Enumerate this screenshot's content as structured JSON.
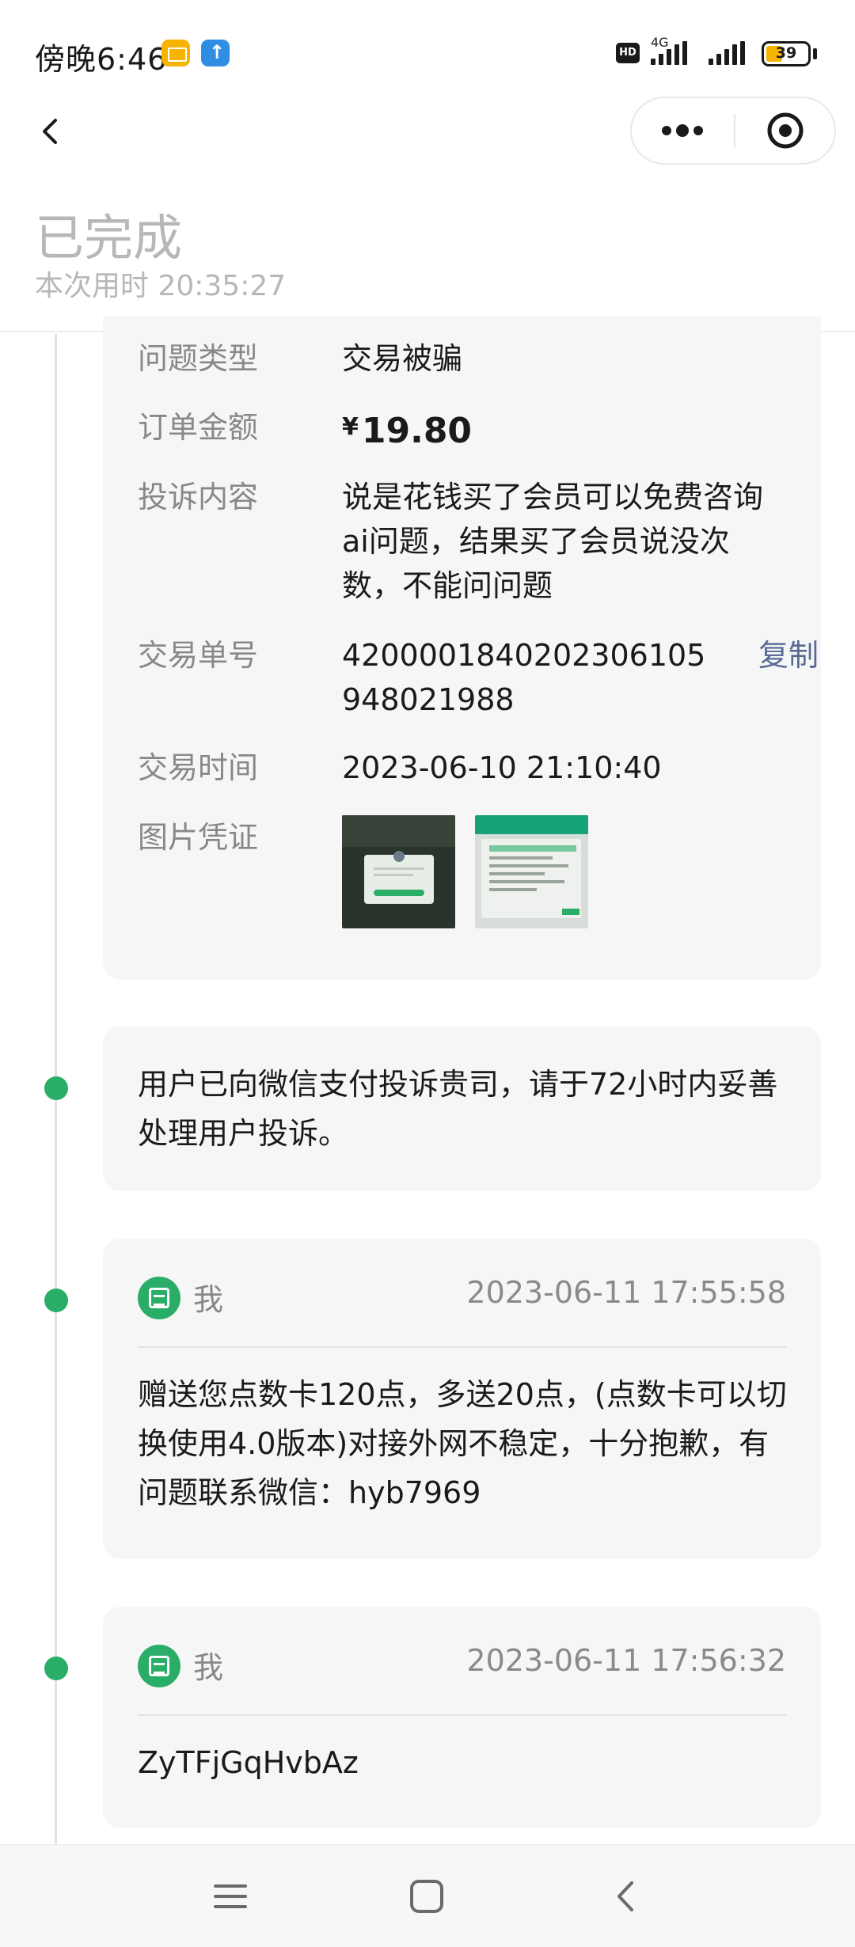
{
  "status_bar": {
    "time": "傍晚6:46",
    "hd": "HD",
    "network": "4G",
    "battery": "39",
    "icons": [
      "mail-notification-icon",
      "upload-notification-icon",
      "signal-icon",
      "battery-icon"
    ]
  },
  "nav": {
    "icons": [
      "back-arrow-icon",
      "more-dots-icon",
      "close-target-icon"
    ]
  },
  "header": {
    "title": "已完成",
    "elapsed": "本次用时 20:35:27"
  },
  "details": {
    "type_label": "问题类型",
    "type_value": "交易被骗",
    "amount_label": "订单金额",
    "amount_currency": "¥",
    "amount_value": "19.80",
    "content_label": "投诉内容",
    "content_value": "说是花钱买了会员可以免费咨询ai问题，结果买了会员说没次数，不能问问题",
    "txn_label": "交易单号",
    "txn_value": "4200001840202306105948021988",
    "copy_label": "复制",
    "time_label": "交易时间",
    "time_value": "2023-06-10 21:10:40",
    "evidence_label": "图片凭证"
  },
  "notice": {
    "text": "用户已向微信支付投诉贵司，请于72小时内妥善处理用户投诉。"
  },
  "messages": [
    {
      "author": "我",
      "time": "2023-06-11 17:55:58",
      "text": "赠送您点数卡120点，多送20点，(点数卡可以切换使用4.0版本)对接外网不稳定，十分抱歉，有问题联系微信：hyb7969"
    },
    {
      "author": "我",
      "time": "2023-06-11 17:56:32",
      "text": "ZyTFjGqHvbAz"
    }
  ],
  "bottom_nav": {
    "icons": [
      "menu-icon",
      "home-icon",
      "back-icon"
    ]
  },
  "colors": {
    "accent_green": "#2aae67",
    "link_blue": "#576b95",
    "muted_text": "#888888",
    "card_bg": "#f6f6f6"
  }
}
